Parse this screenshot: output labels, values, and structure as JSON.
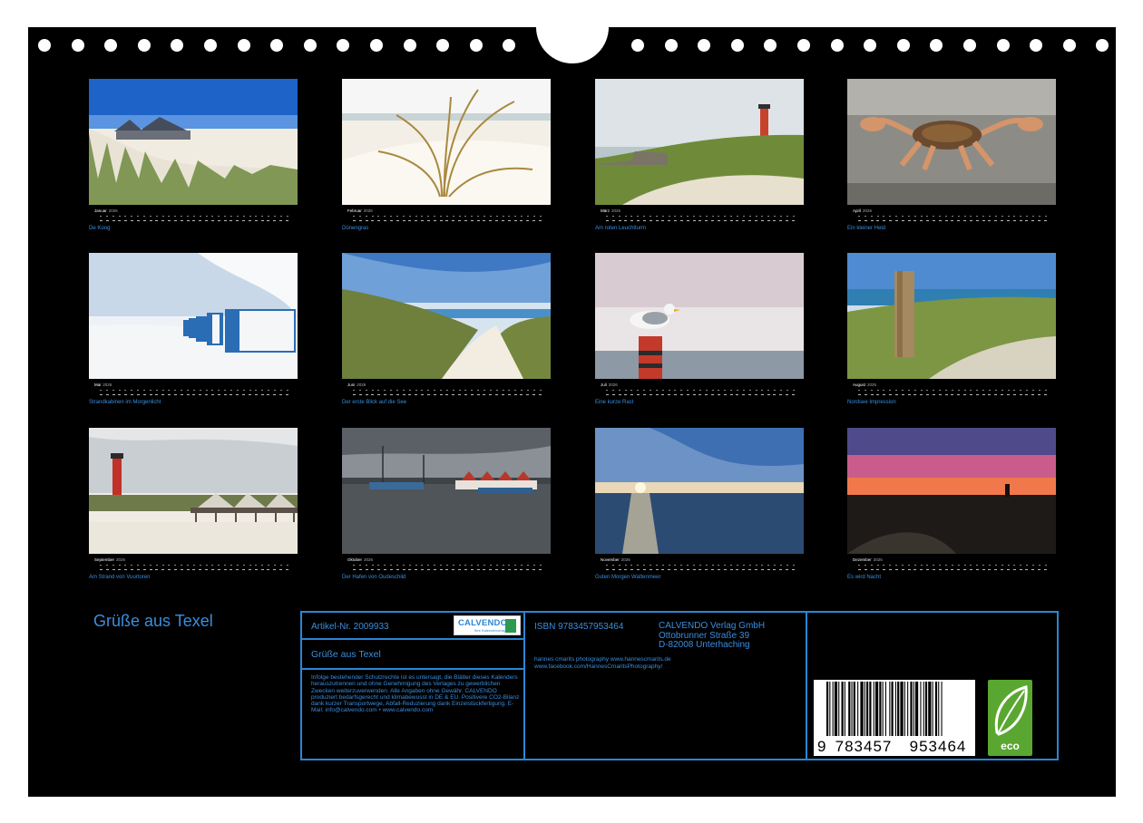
{
  "months": [
    {
      "name": "Januar",
      "year": "2026",
      "caption": "De Koog",
      "scene": "beach-house"
    },
    {
      "name": "Februar",
      "year": "2026",
      "caption": "Dünengras",
      "scene": "dune-grass"
    },
    {
      "name": "März",
      "year": "2026",
      "caption": "Am roten Leuchtturm",
      "scene": "lighthouse-dune"
    },
    {
      "name": "April",
      "year": "2026",
      "caption": "Ein kleiner Held",
      "scene": "crab"
    },
    {
      "name": "Mai",
      "year": "2026",
      "caption": "Strandkabinen im Morgenlicht",
      "scene": "beach-huts"
    },
    {
      "name": "Juni",
      "year": "2026",
      "caption": "Der erste Blick auf die See",
      "scene": "dune-path"
    },
    {
      "name": "Juli",
      "year": "2026",
      "caption": "Eine kurze Rast",
      "scene": "seagull"
    },
    {
      "name": "August",
      "year": "2026",
      "caption": "Nordsee Impression",
      "scene": "wood-post"
    },
    {
      "name": "September",
      "year": "2026",
      "caption": "Am Strand von Vuurtoren",
      "scene": "pier-lighthouse"
    },
    {
      "name": "Oktober",
      "year": "2026",
      "caption": "Der Hafen von Oudeschild",
      "scene": "harbour"
    },
    {
      "name": "November",
      "year": "2026",
      "caption": "Guten Morgen Wattenmeer",
      "scene": "sunrise"
    },
    {
      "name": "Dezember",
      "year": "2026",
      "caption": "Es wird Nacht",
      "scene": "dusk"
    }
  ],
  "cover_title": "Grüße aus Texel",
  "info": {
    "article_label": "Artikel-Nr. 2009933",
    "title": "Grüße aus Texel",
    "isbn": "ISBN 9783457953464",
    "publisher": [
      "CALVENDO Verlag GmbH",
      "Ottobrunner Straße 39",
      "D-82008 Unterhaching"
    ],
    "photographer": [
      "hannes cmarits photography www.hannescmarits.de",
      "www.facebook.com/HannesCmaritsPhotography/"
    ],
    "legal": "Infolge bestehender Schutzrechte ist es untersagt, die Blätter dieses Kalenders herauszutrennen und ohne Genehmigung des Verlages zu gewerblichen Zwecken weiterzuverwenden. Alle Angaben ohne Gewähr. CALVENDO produziert bedarfsgerecht und klimabewusst in DE & EU. Positivere CO2-Bilanz dank kurzer Transportwege, Abfall-Reduzierung dank Einzelstückfertigung. E-Mail: info@calvendo.com • www.calvendo.com",
    "logo_text": "CALVENDO",
    "logo_sub": "Ihre Kalendervorlage",
    "barcode_digits": [
      "9",
      "783457",
      "953464"
    ],
    "eco_label": "eco"
  },
  "colors": {
    "accent": "#3a8ee0",
    "border": "#2b86d4",
    "background": "#000000",
    "eco": "#59a730"
  }
}
